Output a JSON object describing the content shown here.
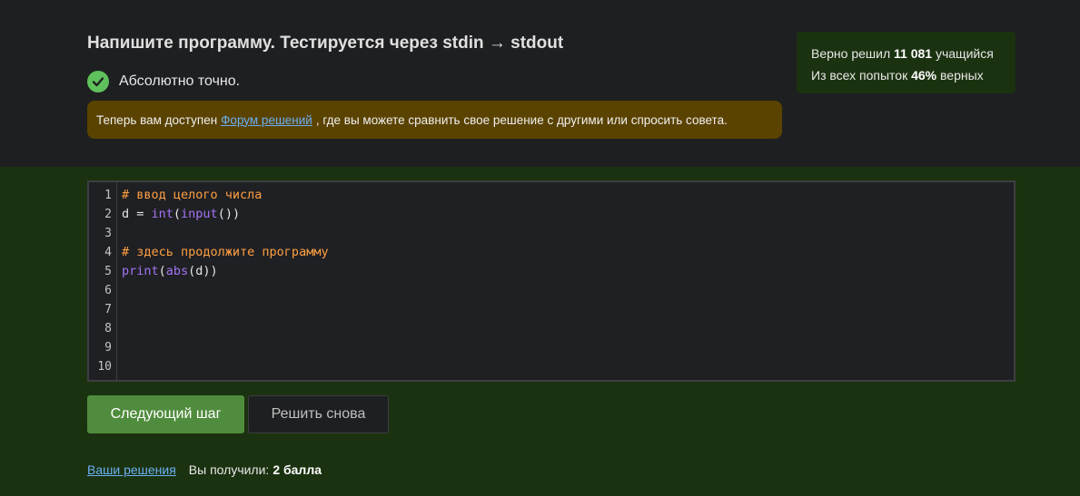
{
  "header": {
    "title": "Напишите программу. Тестируется через stdin → stdout",
    "result_text": "Абсолютно точно."
  },
  "notice": {
    "before": "Теперь вам доступен",
    "link": "Форум решений",
    "after": ", где вы можете сравнить свое решение с другими или спросить совета."
  },
  "stats": {
    "line1_prefix": "Верно решил",
    "solved_count": "11 081",
    "line1_suffix": "учащийся",
    "line2_prefix": "Из всех попыток",
    "percent": "46%",
    "line2_suffix": "верных"
  },
  "editor": {
    "line_numbers": [
      "1",
      "2",
      "3",
      "4",
      "5",
      "6",
      "7",
      "8",
      "9",
      "10"
    ],
    "lines": [
      [
        {
          "t": "# ввод целого числа",
          "c": "cm"
        }
      ],
      [
        {
          "t": "d = ",
          "c": ""
        },
        {
          "t": "int",
          "c": "fn"
        },
        {
          "t": "(",
          "c": ""
        },
        {
          "t": "input",
          "c": "fn"
        },
        {
          "t": "())",
          "c": ""
        }
      ],
      [],
      [
        {
          "t": "# здесь продолжите программу",
          "c": "cm"
        }
      ],
      [
        {
          "t": "print",
          "c": "fn"
        },
        {
          "t": "(",
          "c": ""
        },
        {
          "t": "abs",
          "c": "fn"
        },
        {
          "t": "(d))",
          "c": ""
        }
      ],
      [],
      [],
      [],
      [],
      []
    ]
  },
  "buttons": {
    "next": "Следующий шаг",
    "retry": "Решить снова"
  },
  "footer": {
    "solutions_link": "Ваши решения",
    "got_label": "Вы получили:",
    "points": "2 балла"
  },
  "colors": {
    "accent_green": "#508c3d",
    "check_green": "#5fc15b",
    "notice_bg": "#5a4200",
    "link": "#6ab0f3",
    "comment": "#ff9f43",
    "function": "#a474f4"
  }
}
